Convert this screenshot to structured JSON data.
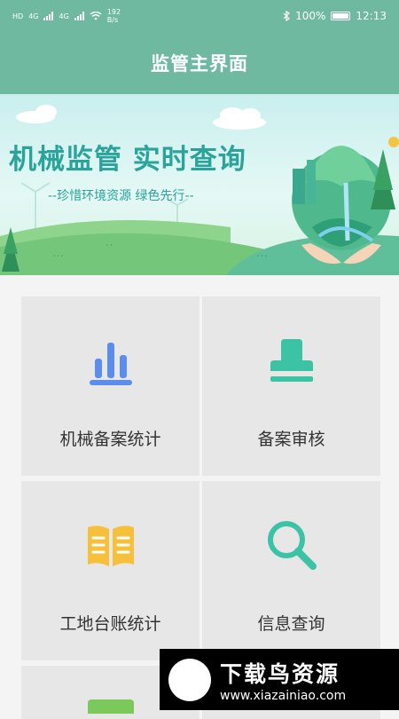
{
  "status": {
    "left_hd1": "HD",
    "left_4g1": "4G",
    "left_4g2": "4G",
    "speed_value": "192",
    "speed_unit": "B/s",
    "battery": "100%",
    "time": "12:13"
  },
  "header": {
    "title": "监管主界面"
  },
  "banner": {
    "title": "机械监管  实时查询",
    "subtitle": "--珍惜环境资源 绿色先行--"
  },
  "menu": [
    {
      "label": "机械备案统计",
      "icon": "bar-chart-icon",
      "color": "#5b8def"
    },
    {
      "label": "备案审核",
      "icon": "stamp-icon",
      "color": "#3cc3a6"
    },
    {
      "label": "工地台账统计",
      "icon": "open-book-icon",
      "color": "#f7c03a"
    },
    {
      "label": "信息查询",
      "icon": "search-icon",
      "color": "#3cc3a6"
    }
  ],
  "watermark": {
    "name": "下载鸟资源",
    "url": "www.xiazainiao.com"
  }
}
